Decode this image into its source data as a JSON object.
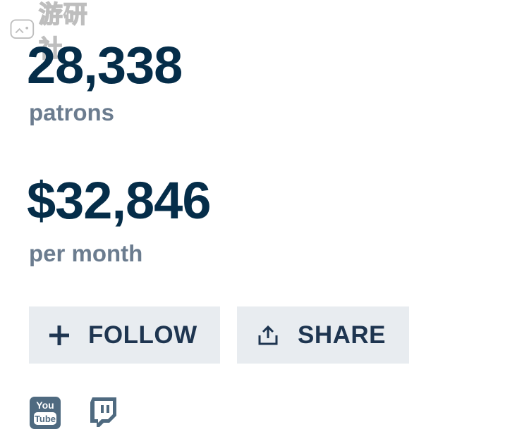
{
  "watermark": {
    "text": "游研社"
  },
  "stats": {
    "patrons": {
      "value": "28,338",
      "label": "patrons"
    },
    "earnings": {
      "value": "$32,846",
      "label": "per month"
    }
  },
  "actions": {
    "follow_label": "FOLLOW",
    "follow_icon": "plus-icon",
    "share_label": "SHARE",
    "share_icon": "share-upload-icon"
  },
  "social": {
    "youtube": {
      "icon": "youtube-icon",
      "logo_text_top": "You",
      "logo_text_bottom": "Tube"
    },
    "twitch": {
      "icon": "twitch-icon"
    }
  },
  "colors": {
    "primary_text": "#052d49",
    "secondary_text": "#6b7c8f",
    "button_bg": "#e8ecf0",
    "icon_color": "#4f6a80"
  }
}
